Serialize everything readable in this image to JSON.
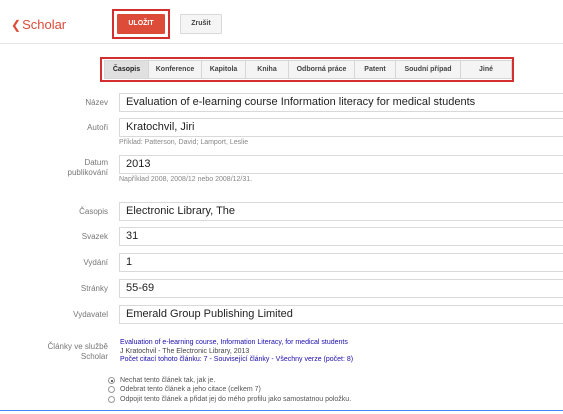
{
  "header": {
    "brand": "Scholar",
    "save_label": "ULOŽIT",
    "cancel_label": "Zrušit"
  },
  "tabs": [
    {
      "label": "Časopis",
      "active": true
    },
    {
      "label": "Konference",
      "active": false
    },
    {
      "label": "Kapitola",
      "active": false
    },
    {
      "label": "Kniha",
      "active": false
    },
    {
      "label": "Odborná práce",
      "active": false
    },
    {
      "label": "Patent",
      "active": false
    },
    {
      "label": "Soudní případ",
      "active": false
    },
    {
      "label": "Jiné",
      "active": false
    }
  ],
  "form": {
    "title": {
      "label": "Název",
      "value": "Evaluation of e-learning course Information literacy for medical students"
    },
    "authors": {
      "label": "Autoři",
      "value": "Kratochvil, Jiri",
      "hint": "Příklad: Patterson, David; Lamport, Leslie"
    },
    "date": {
      "label_line1": "Datum",
      "label_line2": "publikování",
      "value": "2013",
      "hint": "Například 2008, 2008/12 nebo 2008/12/31."
    },
    "journal": {
      "label": "Časopis",
      "value": "Electronic Library, The"
    },
    "volume": {
      "label": "Svazek",
      "value": "31"
    },
    "issue": {
      "label": "Vydání",
      "value": "1"
    },
    "pages": {
      "label": "Stránky",
      "value": "55-69"
    },
    "publisher": {
      "label": "Vydavatel",
      "value": "Emerald Group Publishing Limited"
    }
  },
  "related": {
    "label_line1": "Články ve službě",
    "label_line2": "Scholar",
    "article_link": "Evaluation of e-learning course, Information Literacy, for medical students",
    "source": "J Kratochvil - The Electronic Library, 2013",
    "cited_by": "Počet citací tohoto článku: 7",
    "sep1": " - ",
    "related_articles": "Související články",
    "sep2": " - ",
    "all_versions": "Všechny verze (počet: 8)"
  },
  "options": [
    {
      "label": "Nechat tento článek tak, jak je.",
      "checked": true
    },
    {
      "label": "Odebrat tento článek a jeho citace (celkem 7)",
      "checked": false
    },
    {
      "label": "Odpojit tento článek a přidat jej do mého profilu jako samostatnou položku.",
      "checked": false
    }
  ]
}
